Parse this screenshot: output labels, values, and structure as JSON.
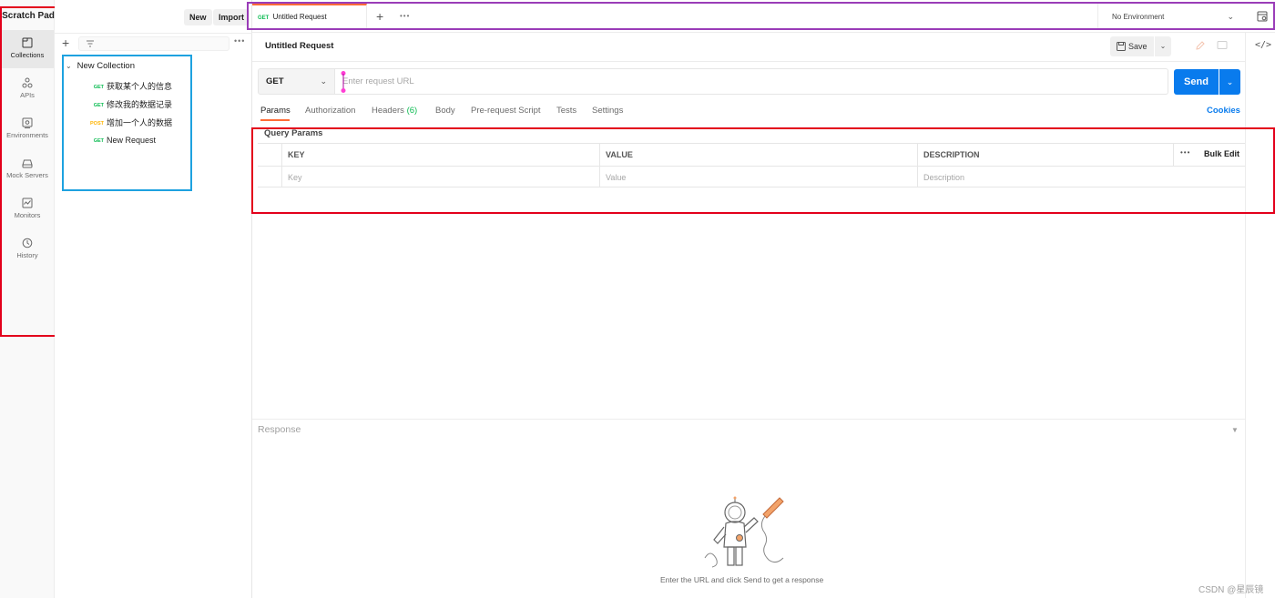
{
  "rail": {
    "title": "Scratch Pad",
    "items": [
      {
        "label": "Collections",
        "icon": "collections-icon"
      },
      {
        "label": "APIs",
        "icon": "apis-icon"
      },
      {
        "label": "Environments",
        "icon": "environments-icon"
      },
      {
        "label": "Mock Servers",
        "icon": "mock-servers-icon"
      },
      {
        "label": "Monitors",
        "icon": "monitors-icon"
      },
      {
        "label": "History",
        "icon": "history-icon"
      }
    ]
  },
  "sidebar": {
    "new_label": "New",
    "import_label": "Import",
    "collection_name": "New Collection",
    "requests": [
      {
        "method": "GET",
        "name": "获取某个人的信息"
      },
      {
        "method": "GET",
        "name": "修改我的数据记录"
      },
      {
        "method": "POST",
        "name": "增加一个人的数据"
      },
      {
        "method": "GET",
        "name": "New Request"
      }
    ]
  },
  "tabbar": {
    "tab_method": "GET",
    "tab_title": "Untitled Request",
    "environment": "No Environment"
  },
  "request": {
    "name": "Untitled Request",
    "save_label": "Save",
    "method": "GET",
    "url_placeholder": "Enter request URL",
    "send_label": "Send",
    "tabs": [
      "Params",
      "Authorization",
      "Headers",
      "Body",
      "Pre-request Script",
      "Tests",
      "Settings"
    ],
    "headers_count": "(6)",
    "cookies_label": "Cookies"
  },
  "params": {
    "section_label": "Query Params",
    "columns": [
      "KEY",
      "VALUE",
      "DESCRIPTION"
    ],
    "placeholders": [
      "Key",
      "Value",
      "Description"
    ],
    "bulk_edit_label": "Bulk Edit"
  },
  "response": {
    "label": "Response",
    "hint": "Enter the URL and click Send to get a response"
  },
  "watermark": "CSDN @星辰镜",
  "colors": {
    "accent": "#ff6c37",
    "send": "#097bed",
    "get": "#0cbb52",
    "post": "#ffb400",
    "annotation_red": "#e3001b",
    "annotation_blue": "#1ea2e0",
    "annotation_purple": "#9a3cb8"
  }
}
